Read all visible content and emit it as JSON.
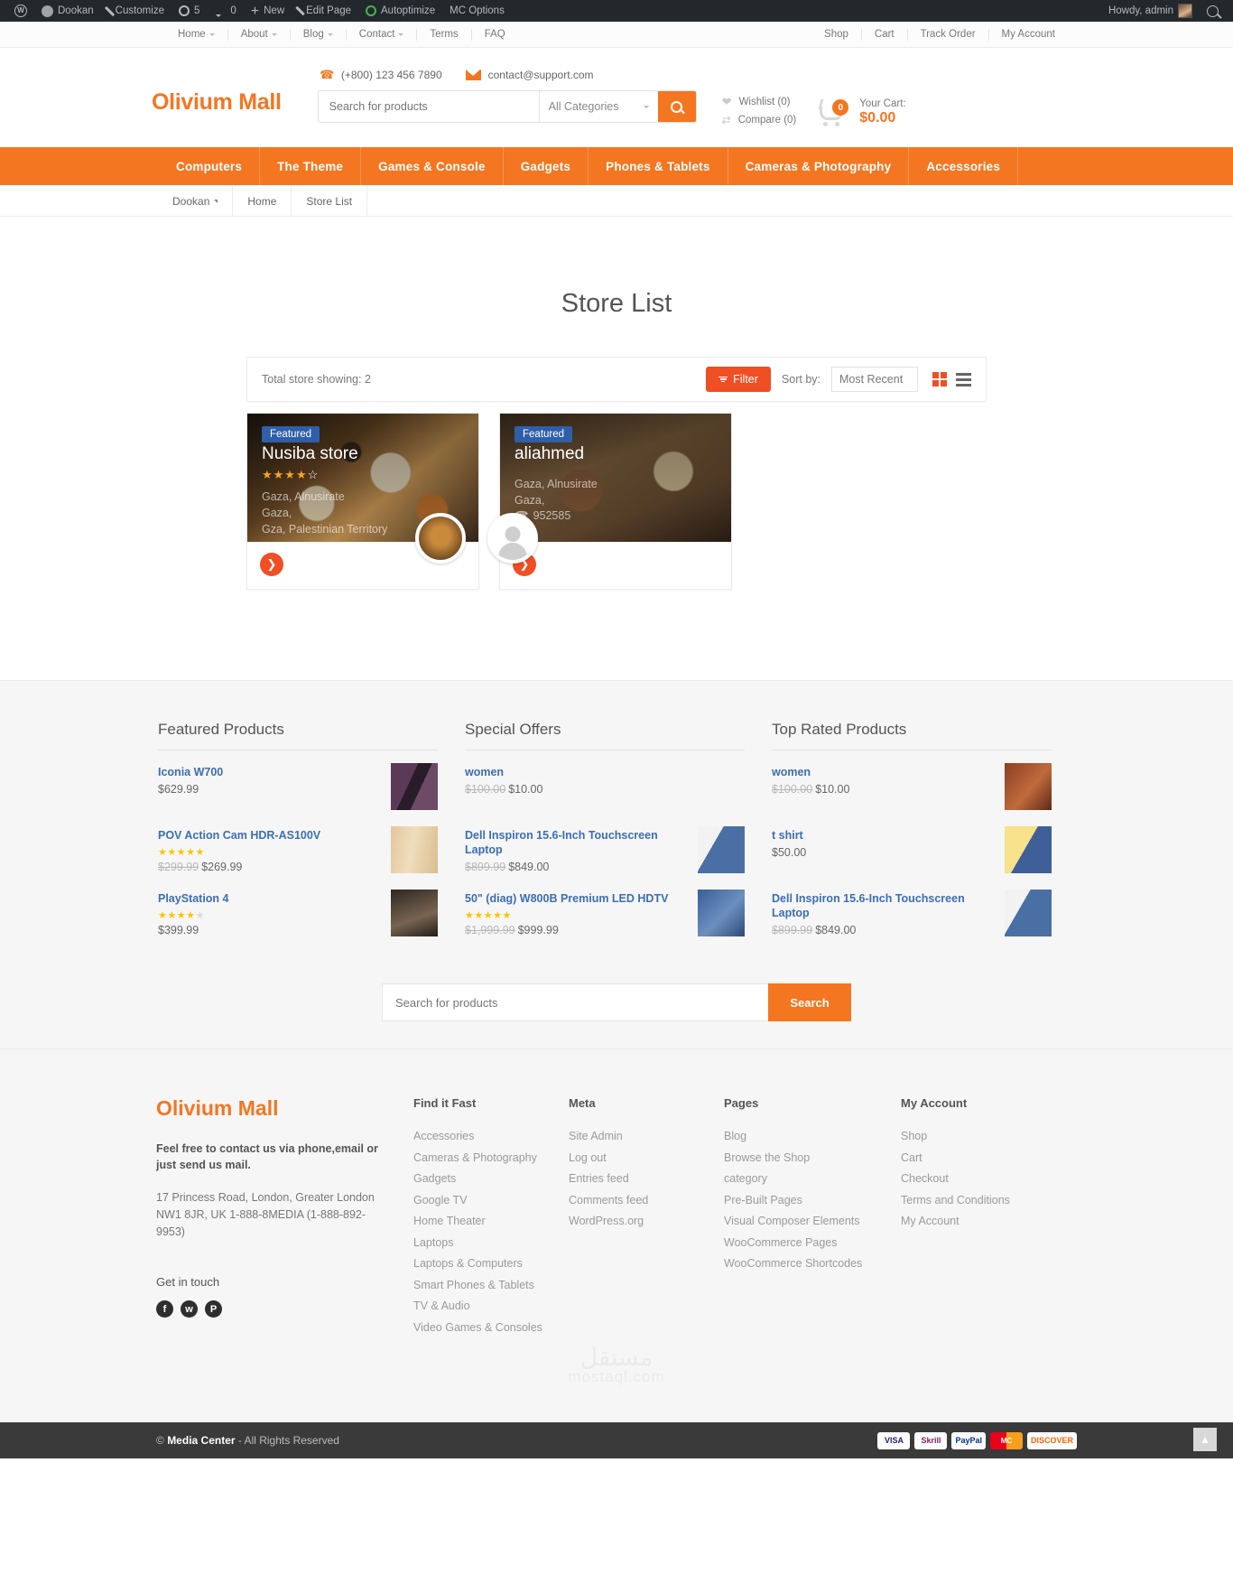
{
  "adminbar": {
    "items": [
      {
        "icon": "wordpress-logo-icon",
        "label": ""
      },
      {
        "icon": "home-icon",
        "label": "Dookan"
      },
      {
        "icon": "brush-icon",
        "label": "Customize"
      },
      {
        "icon": "updates-icon",
        "label": "5"
      },
      {
        "icon": "comment-icon",
        "label": "0"
      },
      {
        "icon": "plus-icon",
        "label": "New"
      },
      {
        "icon": "pencil-icon",
        "label": "Edit Page"
      },
      {
        "icon": "autoptimize-icon",
        "label": "Autoptimize"
      },
      {
        "icon": "",
        "label": "MC Options"
      }
    ],
    "howdy": "Howdy, admin"
  },
  "topnav": {
    "left": [
      {
        "label": "Home",
        "caret": true
      },
      {
        "label": "About",
        "caret": true
      },
      {
        "label": "Blog",
        "caret": true
      },
      {
        "label": "Contact",
        "caret": true
      },
      {
        "label": "Terms",
        "caret": false
      },
      {
        "label": "FAQ",
        "caret": false
      }
    ],
    "right": [
      "Shop",
      "Cart",
      "Track Order",
      "My Account"
    ]
  },
  "header": {
    "logo": "Olivium Mall",
    "phone": "(+800) 123 456 7890",
    "email": "contact@support.com",
    "search_placeholder": "Search for products",
    "category_selected": "All Categories",
    "wishlist": "Wishlist (0)",
    "compare": "Compare (0)",
    "cart_count": "0",
    "cart_label": "Your Cart:",
    "cart_total": "$0.00"
  },
  "mainnav": [
    "Computers",
    "The Theme",
    "Games & Console",
    "Gadgets",
    "Phones & Tablets",
    "Cameras & Photography",
    "Accessories"
  ],
  "breadcrumb": {
    "root": "Dookan",
    "home": "Home",
    "current": "Store List"
  },
  "page": {
    "title": "Store List"
  },
  "store_toolbar": {
    "total": "Total store showing: 2",
    "filter_label": "Filter",
    "sort_label": "Sort by:",
    "sort_value": "Most Recent"
  },
  "stores": [
    {
      "badge": "Featured",
      "name": "Nusiba store",
      "rating": "★★★★☆",
      "rating_value": 3.5,
      "address_line1": "Gaza, Alnusirate",
      "address_line2": "Gaza,",
      "address_line3": "Gza, Palestinian Territory",
      "phone": "",
      "avatar": "pizza-avatar"
    },
    {
      "badge": "Featured",
      "name": "aliahmed",
      "rating": "",
      "rating_value": 0,
      "address_line1": "Gaza, Alnusirate",
      "address_line2": "Gaza,",
      "address_line3": "",
      "phone": "952585",
      "avatar": "user-avatar"
    }
  ],
  "widgets": [
    {
      "title": "Featured Products",
      "products": [
        {
          "name": "Iconia W700",
          "stars": "",
          "old_price": "",
          "price": "$629.99",
          "thumb": "th1"
        },
        {
          "name": "POV Action Cam HDR-AS100V",
          "stars": "★★★★★",
          "old_price": "$299.99",
          "price": "$269.99",
          "thumb": "th2"
        },
        {
          "name": "PlayStation 4",
          "stars": "★★★★☆",
          "old_price": "",
          "price": "$399.99",
          "thumb": "th3"
        }
      ]
    },
    {
      "title": "Special Offers",
      "products": [
        {
          "name": "women",
          "stars": "",
          "old_price": "$100.00",
          "price": "$10.00",
          "thumb": "th4"
        },
        {
          "name": "Dell Inspiron 15.6-Inch Touchscreen Laptop",
          "stars": "",
          "old_price": "$899.99",
          "price": "$849.00",
          "thumb": "th5"
        },
        {
          "name": "50\" (diag) W800B Premium LED HDTV",
          "stars": "★★★★★",
          "old_price": "$1,999.99",
          "price": "$999.99",
          "thumb": "th6"
        }
      ]
    },
    {
      "title": "Top Rated Products",
      "products": [
        {
          "name": "women",
          "stars": "",
          "old_price": "$100.00",
          "price": "$10.00",
          "thumb": "th7"
        },
        {
          "name": "t shirt",
          "stars": "",
          "old_price": "",
          "price": "$50.00",
          "thumb": "th8"
        },
        {
          "name": "Dell Inspiron 15.6-Inch Touchscreen Laptop",
          "stars": "",
          "old_price": "$899.99",
          "price": "$849.00",
          "thumb": "th5"
        }
      ]
    }
  ],
  "footer_search": {
    "placeholder": "Search for products",
    "button": "Search"
  },
  "footer": {
    "logo": "Olivium Mall",
    "tagline": "Feel free to contact us via phone,email or just send us mail.",
    "address": "17 Princess Road, London, Greater London NW1 8JR, UK 1-888-8MEDIA (1-888-892-9953)",
    "get_in_touch": "Get in touch",
    "socials": [
      "facebook-icon",
      "twitter-icon",
      "pinterest-icon"
    ],
    "columns": [
      {
        "title": "Find it Fast",
        "links": [
          "Accessories",
          "Cameras & Photography",
          "Gadgets",
          "Google TV",
          "Home Theater",
          "Laptops",
          "Laptops & Computers",
          "Smart Phones & Tablets",
          "TV & Audio",
          "Video Games & Consoles"
        ]
      },
      {
        "title": "Meta",
        "links": [
          "Site Admin",
          "Log out",
          "Entries feed",
          "Comments feed",
          "WordPress.org"
        ]
      },
      {
        "title": "Pages",
        "links": [
          "Blog",
          "Browse the Shop",
          "category",
          "Pre-Built Pages",
          "Visual Composer Elements",
          "WooCommerce Pages",
          "WooCommerce Shortcodes"
        ]
      },
      {
        "title": "My Account",
        "links": [
          "Shop",
          "Cart",
          "Checkout",
          "Terms and Conditions",
          "My Account"
        ]
      }
    ]
  },
  "watermark": {
    "arabic": "مستقل",
    "latin": "mostaql.com"
  },
  "bottombar": {
    "copyright_brand": "Media Center",
    "copyright_rest": "- All Rights Reserved",
    "copyright_prefix": "©",
    "payments": [
      "VISA",
      "Skrill",
      "PayPal",
      "MC",
      "DISCOVER"
    ]
  }
}
